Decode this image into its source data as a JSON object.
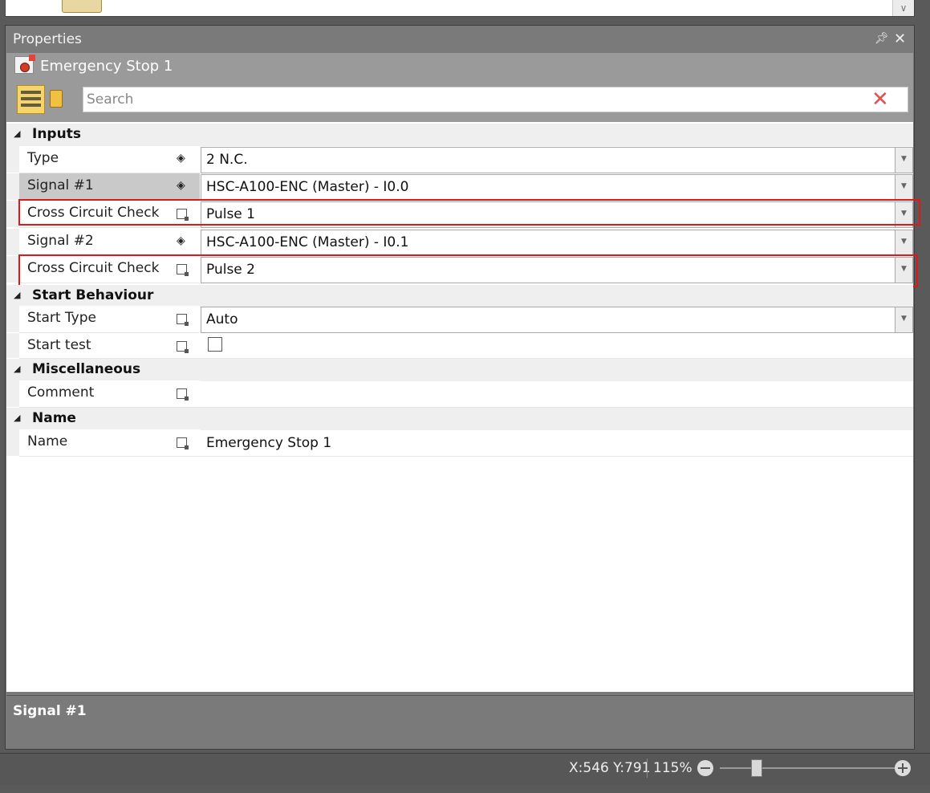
{
  "panel": {
    "title": "Properties",
    "object_name": "Emergency Stop 1",
    "search_placeholder": "Search",
    "icons": [
      "pin-icon",
      "close-icon",
      "emergency-stop-icon",
      "categorized-view-icon",
      "alphabetical-view-icon",
      "clear-search-icon"
    ]
  },
  "categories": {
    "inputs": "Inputs",
    "start_behaviour": "Start Behaviour",
    "miscellaneous": "Miscellaneous",
    "name": "Name"
  },
  "properties": {
    "type": {
      "label": "Type",
      "value": "2 N.C."
    },
    "signal1": {
      "label": "Signal #1",
      "value": "HSC-A100-ENC (Master) - I0.0"
    },
    "cross1": {
      "label": "Cross Circuit Check",
      "value": "Pulse 1"
    },
    "signal2": {
      "label": "Signal #2",
      "value": "HSC-A100-ENC (Master) - I0.1"
    },
    "cross2": {
      "label": "Cross Circuit Check",
      "value": "Pulse 2"
    },
    "start_type": {
      "label": "Start Type",
      "value": "Auto"
    },
    "start_test": {
      "label": "Start test",
      "checked": false
    },
    "comment": {
      "label": "Comment",
      "value": ""
    },
    "name": {
      "label": "Name",
      "value": "Emergency Stop 1"
    }
  },
  "description": {
    "title": "Signal #1"
  },
  "status": {
    "coords": "X:546 Y:791",
    "zoom": "115%"
  },
  "colors": {
    "highlight": "#e01818",
    "panel_bg": "#7a7a7a",
    "category_bg": "#efefef",
    "selected_row": "#c9c9c9"
  }
}
